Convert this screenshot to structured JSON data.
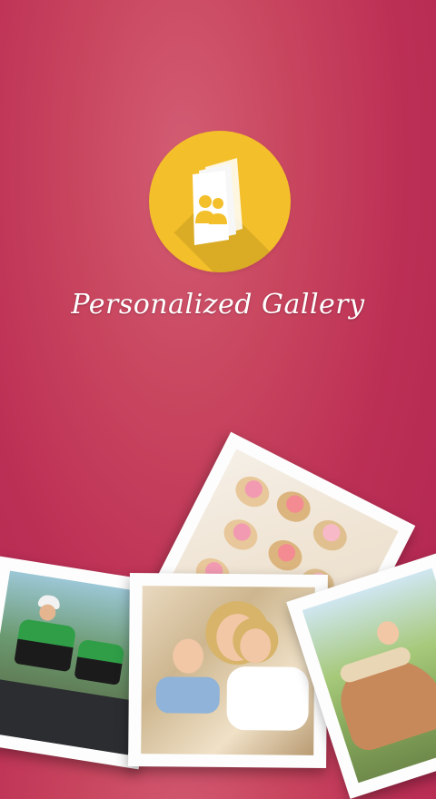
{
  "app": {
    "title": "Personalized Gallery",
    "logo_icon": "gallery-album-people-icon"
  },
  "colors": {
    "background": "#b92a53",
    "logo_circle": "#f3bf2a",
    "title_text": "#ffffff"
  },
  "photos": [
    {
      "name": "food-photo",
      "subject": "cupcakes"
    },
    {
      "name": "cyclist-photo",
      "subject": "cyclists"
    },
    {
      "name": "family-photo",
      "subject": "family"
    },
    {
      "name": "horse-photo",
      "subject": "horse"
    }
  ]
}
